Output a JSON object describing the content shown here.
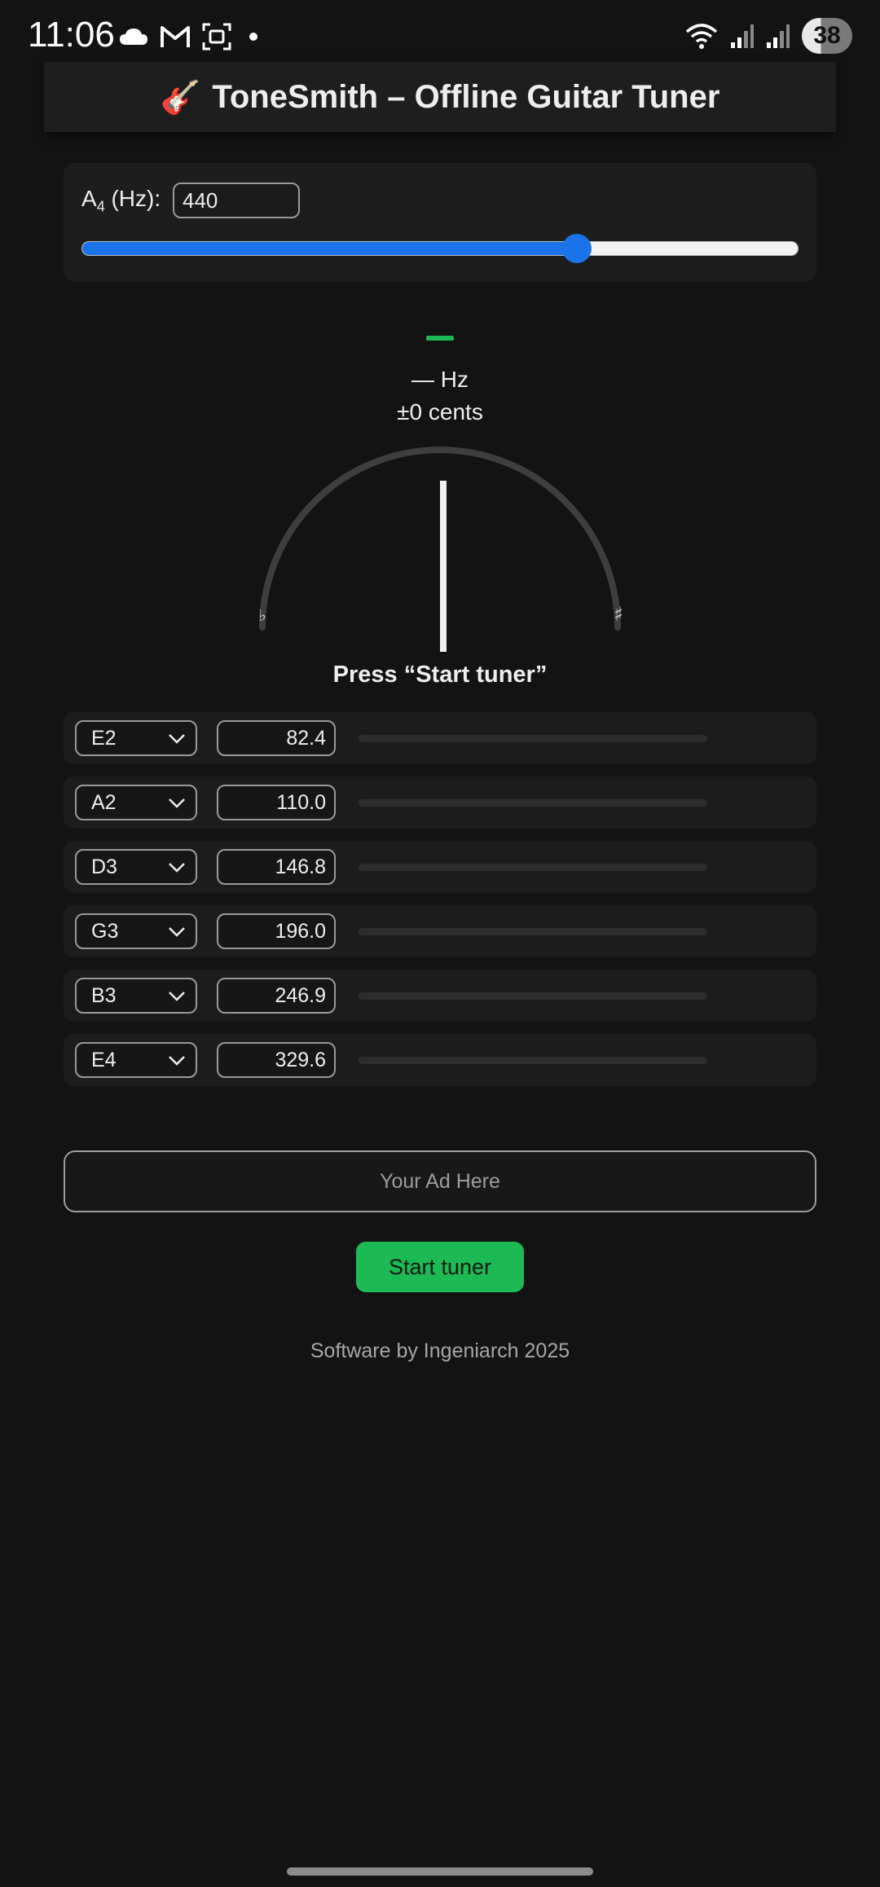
{
  "status_bar": {
    "time": "11:06",
    "battery": "38",
    "left_icons": [
      "cloud-icon",
      "gmail-icon",
      "screenshot-icon",
      "dot-icon"
    ],
    "right_icons": [
      "wifi-icon",
      "signal-icon",
      "signal-icon"
    ]
  },
  "header": {
    "emoji": "🎸",
    "title": "ToneSmith – Offline Guitar Tuner"
  },
  "reference": {
    "label_main": "A",
    "label_sub": "4",
    "label_unit": " (Hz):",
    "value": "440",
    "slider_fraction": 0.69
  },
  "readout": {
    "note": "",
    "frequency": "— Hz",
    "cents": "±0 cents",
    "flat_symbol": "♭",
    "sharp_symbol": "♯",
    "status": "Press “Start tuner”"
  },
  "strings": [
    {
      "note": "E2",
      "freq": "82.4"
    },
    {
      "note": "A2",
      "freq": "110.0"
    },
    {
      "note": "D3",
      "freq": "146.8"
    },
    {
      "note": "G3",
      "freq": "196.0"
    },
    {
      "note": "B3",
      "freq": "246.9"
    },
    {
      "note": "E4",
      "freq": "329.6"
    }
  ],
  "ad": {
    "text": "Your Ad Here"
  },
  "start_button": {
    "label": "Start tuner"
  },
  "footer": {
    "text": "Software by Ingeniarch 2025"
  },
  "colors": {
    "background": "#131313",
    "accent_green": "#1db954",
    "slider_blue": "#1a73e8"
  }
}
